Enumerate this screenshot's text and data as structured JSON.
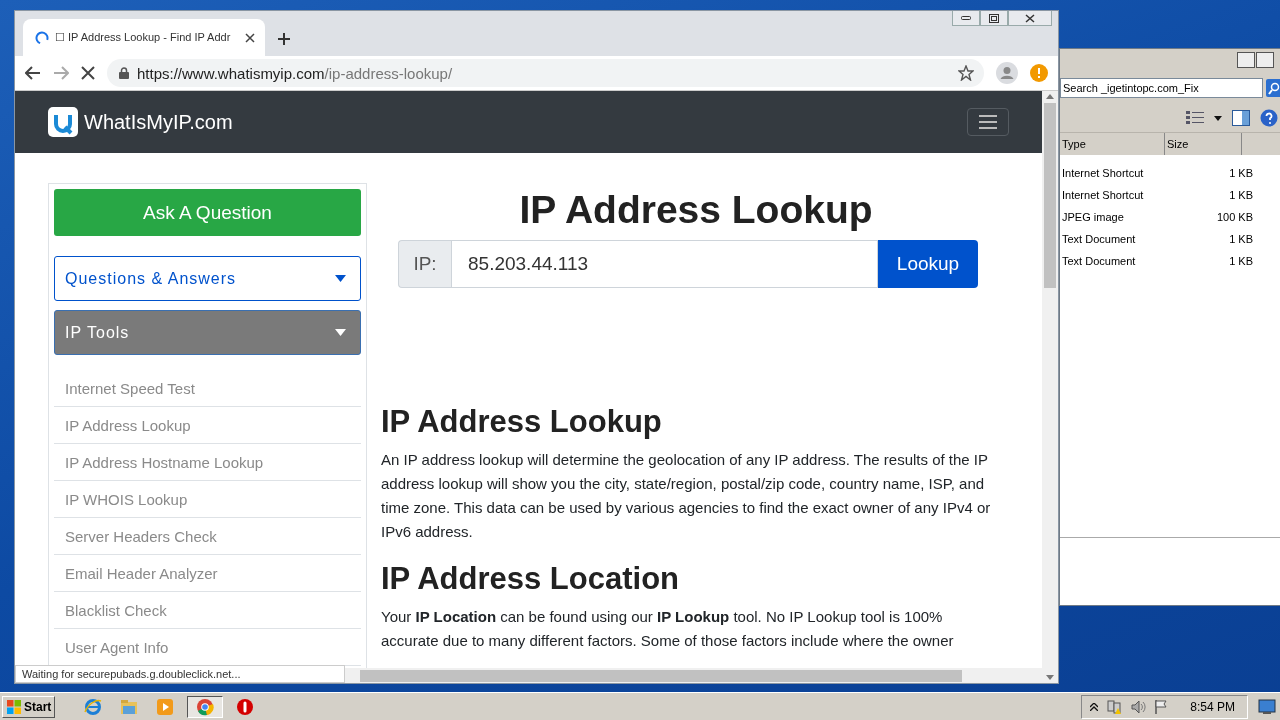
{
  "browser": {
    "tab": {
      "title": "☐ IP Address Lookup - Find IP Addr",
      "loading": true
    },
    "address": {
      "host": "https://www.whatismyip.com",
      "path": "/ip-address-lookup/"
    },
    "status": "Waiting for securepubads.g.doubleclick.net...",
    "page": {
      "brand": "WhatIsMyIP.com",
      "sidebar": {
        "ask": "Ask A Question",
        "menus": [
          {
            "label": "Questions & Answers",
            "expanded": false
          },
          {
            "label": "IP Tools",
            "expanded": true
          }
        ],
        "links": [
          "Internet Speed Test",
          "IP Address Lookup",
          "IP Address Hostname Lookup",
          "IP WHOIS Lookup",
          "Server Headers Check",
          "Email Header Analyzer",
          "Blacklist Check",
          "User Agent Info"
        ]
      },
      "title": "IP Address Lookup",
      "ip_label": "IP:",
      "ip_value": "85.203.44.113",
      "lookup": "Lookup",
      "sections": [
        {
          "heading": "IP Address Lookup",
          "text": "An IP address lookup will determine the geolocation of any IP address. The results of the IP address lookup will show you the city, state/region, postal/zip code, country name, ISP, and time zone. This data can be used by various agencies to find the exact owner of any IPv4 or IPv6 address."
        },
        {
          "heading": "IP Address Location",
          "text": "Your **IP Location** can be found using our **IP Lookup** tool. No IP Lookup tool is 100% accurate due to many different factors. Some of those factors include where the owner"
        }
      ]
    }
  },
  "explorer": {
    "search": "Search _igetintopc.com_Fix",
    "columns": [
      "Type",
      "Size"
    ],
    "rows": [
      {
        "type": "Internet Shortcut",
        "size": "1 KB"
      },
      {
        "type": "Internet Shortcut",
        "size": "1 KB"
      },
      {
        "type": "JPEG image",
        "size": "100 KB"
      },
      {
        "type": "Text Document",
        "size": "1 KB"
      },
      {
        "type": "Text Document",
        "size": "1 KB"
      }
    ]
  },
  "taskbar": {
    "start": "Start",
    "clock": "8:54 PM",
    "apps": [
      {
        "kind": "ie",
        "selected": false
      },
      {
        "kind": "folder",
        "selected": false
      },
      {
        "kind": "media",
        "selected": false
      },
      {
        "kind": "chrome",
        "selected": true
      },
      {
        "kind": "stop",
        "selected": false
      }
    ]
  }
}
